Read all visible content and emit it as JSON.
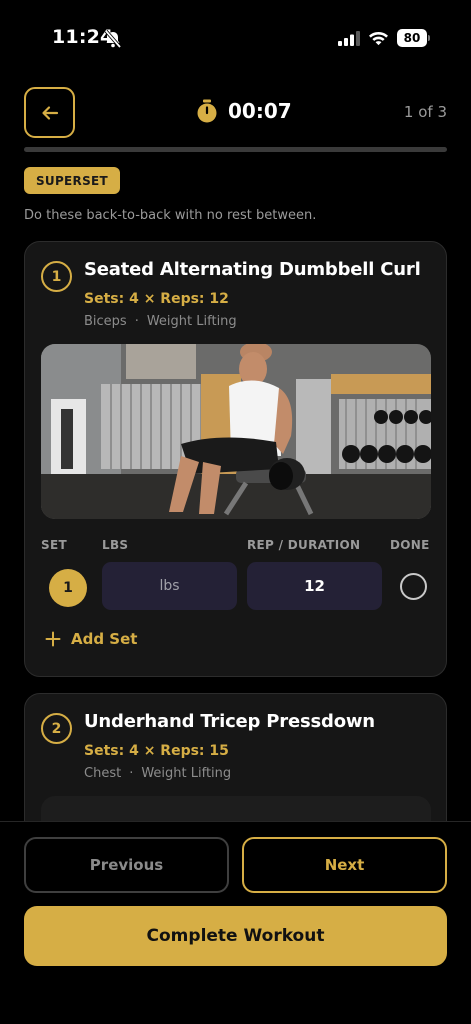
{
  "status": {
    "time": "11:24",
    "battery": "80"
  },
  "header": {
    "timer": "00:07",
    "progress_label": "1 of 3",
    "progress_fraction": 0
  },
  "superset": {
    "badge": "SUPERSET",
    "description": "Do these back-to-back with no rest between."
  },
  "exercises": [
    {
      "number": "1",
      "title": "Seated Alternating Dumbbell Curl",
      "sets_reps": "Sets: 4 × Reps: 12",
      "muscle": "Biceps",
      "category": "Weight Lifting",
      "columns": {
        "set": "SET",
        "lbs": "LBS",
        "reps": "REP / DURATION",
        "done": "DONE"
      },
      "set_rows": [
        {
          "set": "1",
          "lbs_placeholder": "lbs",
          "reps": "12",
          "done": false
        }
      ],
      "add_set": "Add Set"
    },
    {
      "number": "2",
      "title": "Underhand Tricep Pressdown",
      "sets_reps": "Sets: 4 × Reps: 15",
      "muscle": "Chest",
      "category": "Weight Lifting"
    }
  ],
  "footer": {
    "previous": "Previous",
    "next": "Next",
    "complete": "Complete Workout"
  },
  "colors": {
    "accent": "#d6ae45",
    "background": "#000000",
    "card": "#161616",
    "input": "#242136"
  },
  "icons": [
    "bell-off-icon",
    "signal-icon",
    "wifi-icon",
    "battery-icon",
    "arrow-left-icon",
    "stopwatch-icon",
    "plus-icon",
    "circle-check-icon"
  ]
}
